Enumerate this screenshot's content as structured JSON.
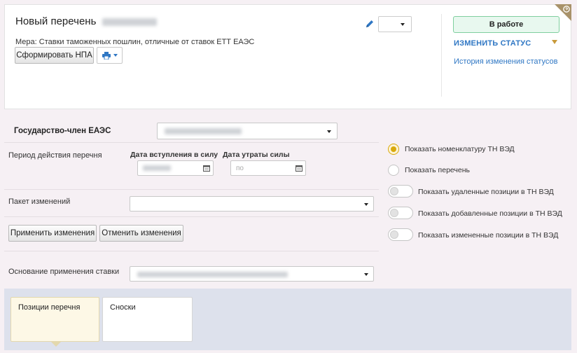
{
  "header": {
    "title": "Новый перечень",
    "measure": "Мера: Ставки таможенных пошлин, отличные от ставок ЕТТ ЕАЭС",
    "form_npa_button": "Сформировать НПА",
    "print_icon": "printer-icon",
    "edit_icon": "pencil-icon",
    "status": "В работе",
    "change_status": "ИЗМЕНИТЬ СТАТУС",
    "status_history": "История изменения статусов",
    "help_icon": "question-icon",
    "colors": {
      "status_bg": "#e8f8ef",
      "status_border": "#7fcf9e",
      "link": "#2f77c4",
      "accent": "#d9a90c"
    }
  },
  "form": {
    "member_state_label": "Государство-член ЕАЭС",
    "period_label": "Период действия перечня",
    "start_date_label": "Дата вступления в силу",
    "end_date_label": "Дата утраты силы",
    "end_date_placeholder": "по",
    "calendar_icon": "calendar-icon",
    "package_label": "Пакет изменений",
    "apply_button": "Применить изменения",
    "cancel_button": "Отменить изменения",
    "basis_label": "Основание применения ставки"
  },
  "options": {
    "radios": [
      {
        "label": "Показать номенклатуру ТН ВЭД",
        "selected": true
      },
      {
        "label": "Показать перечень",
        "selected": false
      }
    ],
    "toggles": [
      {
        "label": "Показать удаленные позиции в ТН ВЭД",
        "on": false
      },
      {
        "label": "Показать добавленные позиции в ТН ВЭД",
        "on": false
      },
      {
        "label": "Показать измененные позиции в ТН ВЭД",
        "on": false
      }
    ]
  },
  "tabs": [
    {
      "label": "Позиции перечня",
      "active": true
    },
    {
      "label": "Сноски",
      "active": false
    }
  ]
}
